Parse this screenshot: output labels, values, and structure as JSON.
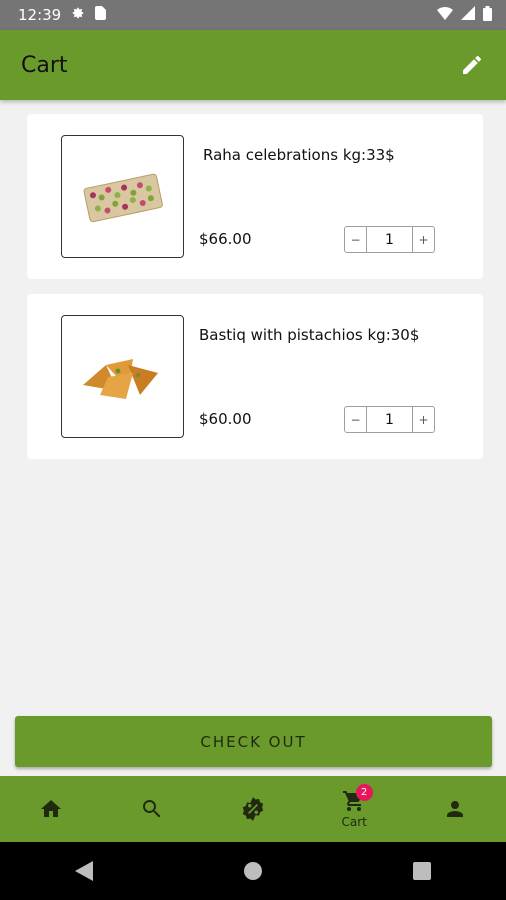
{
  "status_bar": {
    "time": "12:39"
  },
  "header": {
    "title": "Cart"
  },
  "cart": {
    "items": [
      {
        "name": "Raha celebrations kg:33$",
        "price": "$66.00",
        "quantity": "1"
      },
      {
        "name": "Bastiq with pistachios  kg:30$",
        "price": "$60.00",
        "quantity": "1"
      }
    ]
  },
  "checkout": {
    "label": "CHECK OUT"
  },
  "bottom_nav": {
    "cart_label": "Cart",
    "cart_badge": "2",
    "items": [
      "home-icon",
      "search-icon",
      "discount-icon",
      "cart-icon",
      "profile-icon"
    ]
  },
  "theme": {
    "primary": "#6a9a2b",
    "badge": "#e8175d",
    "background": "#f1f1f1"
  }
}
